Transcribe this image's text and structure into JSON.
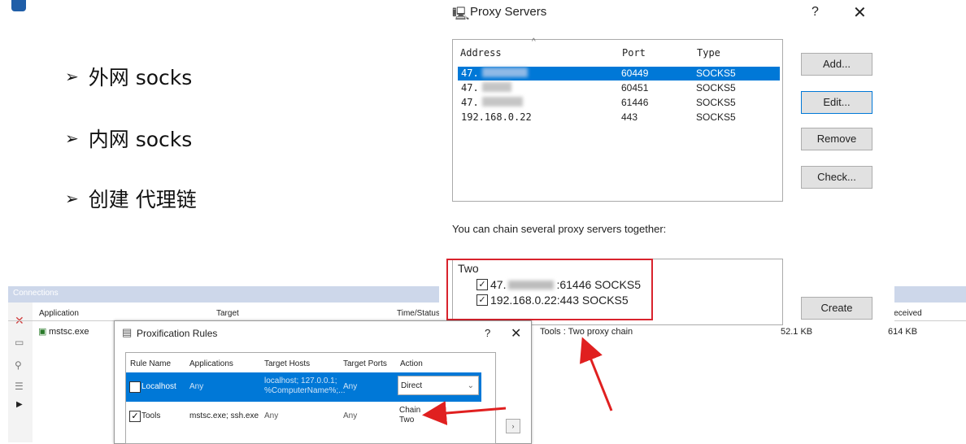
{
  "slide": {
    "bullets": [
      "外网 socks",
      "内网 socks",
      "创建 代理链"
    ],
    "bullet_marker": "➢"
  },
  "proxy_dialog": {
    "title": "Proxy Servers",
    "help": "?",
    "close": "✕",
    "columns": [
      "Address",
      "Port",
      "Type"
    ],
    "rows": [
      {
        "address": "47.",
        "port": "60449",
        "type": "SOCKS5",
        "selected": true
      },
      {
        "address": "47.",
        "port": "60451",
        "type": "SOCKS5",
        "selected": false
      },
      {
        "address": "47.",
        "port": "61446",
        "type": "SOCKS5",
        "selected": false
      },
      {
        "address": "192.168.0.22",
        "port": "443",
        "type": "SOCKS5",
        "selected": false
      }
    ],
    "buttons": {
      "add": "Add...",
      "edit": "Edit...",
      "remove": "Remove",
      "check": "Check...",
      "create": "Create"
    },
    "chain_caption": "You can chain several proxy servers together:",
    "chain": {
      "name": "Two",
      "items": [
        {
          "prefix": "47.",
          "suffix": ":61446 SOCKS5"
        },
        {
          "text": "192.168.0.22:443 SOCKS5"
        }
      ]
    }
  },
  "connections": {
    "title": "Connections",
    "columns": {
      "application": "Application",
      "target": "Target",
      "time_status": "Time/Status",
      "received": "Received"
    },
    "row": {
      "application": "mstsc.exe",
      "rule": "Tools : Two proxy chain",
      "sent": "52.1 KB",
      "received": "614 KB"
    }
  },
  "rules_dialog": {
    "title": "Proxification Rules",
    "help": "?",
    "close": "✕",
    "columns": [
      "Rule Name",
      "Applications",
      "Target Hosts",
      "Target Ports",
      "Action"
    ],
    "rows": [
      {
        "name": "Localhost",
        "apps": "Any",
        "hosts_line1": "localhost; 127.0.0.1;",
        "hosts_line2": "%ComputerName%;...",
        "ports": "Any",
        "action": "Direct",
        "selected": true
      },
      {
        "name": "Tools",
        "apps": "mstsc.exe; ssh.exe",
        "hosts": "Any",
        "ports": "Any",
        "action_line1": "Chain",
        "action_line2": "Two",
        "selected": false
      }
    ]
  },
  "colors": {
    "selection": "#0078d7",
    "highlight": "#d9232d",
    "accent": "#1f5ea8"
  }
}
